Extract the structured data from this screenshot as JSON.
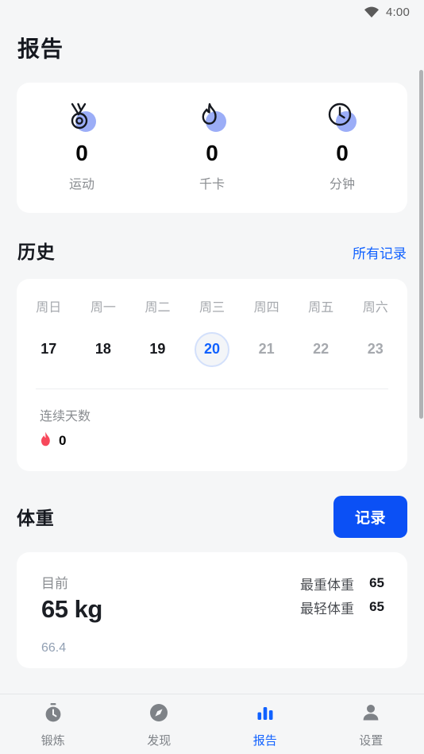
{
  "statusbar": {
    "time": "4:00",
    "wifi_icon": "wifi-icon"
  },
  "header": {
    "title": "报告"
  },
  "stats": {
    "items": [
      {
        "icon": "medal-icon",
        "value": "0",
        "label": "运动"
      },
      {
        "icon": "flame-icon",
        "value": "0",
        "label": "千卡"
      },
      {
        "icon": "clock-icon",
        "value": "0",
        "label": "分钟"
      }
    ],
    "accent_blob_color": "#9BADF7"
  },
  "history": {
    "title": "历史",
    "link": "所有记录",
    "days": [
      {
        "dow": "周日",
        "num": "17",
        "state": "past"
      },
      {
        "dow": "周一",
        "num": "18",
        "state": "past"
      },
      {
        "dow": "周二",
        "num": "19",
        "state": "past"
      },
      {
        "dow": "周三",
        "num": "20",
        "state": "today"
      },
      {
        "dow": "周四",
        "num": "21",
        "state": "future"
      },
      {
        "dow": "周五",
        "num": "22",
        "state": "future"
      },
      {
        "dow": "周六",
        "num": "23",
        "state": "future"
      }
    ],
    "streak": {
      "label": "连续天数",
      "icon": "flame-icon",
      "value": "0",
      "icon_color": "#F7485B"
    }
  },
  "weight": {
    "title": "体重",
    "record_button": "记录",
    "current_label": "目前",
    "current_value": "65 kg",
    "max_label": "最重体重",
    "max_value": "65",
    "min_label": "最轻体重",
    "min_value": "65",
    "chart_axis_label": "66.4"
  },
  "bottomnav": {
    "items": [
      {
        "icon": "stopwatch-icon",
        "label": "锻炼",
        "active": false
      },
      {
        "icon": "compass-icon",
        "label": "发现",
        "active": false
      },
      {
        "icon": "barchart-icon",
        "label": "报告",
        "active": true
      },
      {
        "icon": "person-icon",
        "label": "设置",
        "active": false
      }
    ],
    "active_color": "#1061FF",
    "inactive_color": "#7E8287"
  },
  "colors": {
    "page_bg": "#F5F6F7",
    "card_bg": "#FFFFFF",
    "accent": "#0B50F5"
  }
}
